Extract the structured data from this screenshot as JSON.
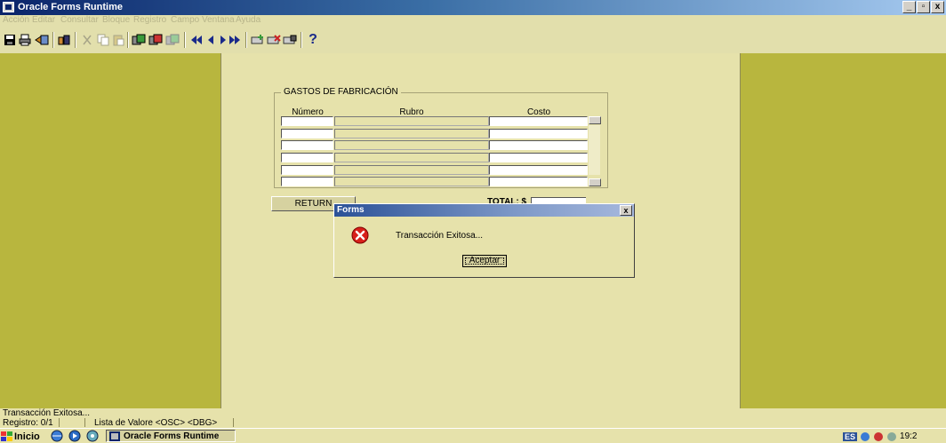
{
  "window": {
    "title": "Oracle Forms Runtime"
  },
  "menu": [
    "Acción",
    "Editar",
    "Consultar",
    "Bloque",
    "Registro",
    "Campo",
    "Ventana",
    "Ayuda"
  ],
  "toolbar": {
    "icons": [
      "save-icon",
      "print-icon",
      "exit-icon",
      "enter-query-icon",
      "cut-icon",
      "copy-icon",
      "paste-icon",
      "insert-record-icon",
      "duplicate-record-icon",
      "clear-record-icon",
      "first-record-icon",
      "previous-record-icon",
      "next-record-icon",
      "last-record-icon",
      "insert-icon",
      "delete-record-icon",
      "lock-record-icon",
      "help-icon"
    ],
    "help_label": "?"
  },
  "form": {
    "frame_title": "GASTOS DE FABRICACIÓN",
    "columns": [
      "Número",
      "Rubro",
      "Costo"
    ],
    "rows": 6,
    "return_label": "RETURN",
    "total_label": "TOTAL: $"
  },
  "dialog": {
    "title": "Forms",
    "close_label": "x",
    "message": "Transacción Exitosa...",
    "ok_label": "Aceptar"
  },
  "status": {
    "message": "Transacción Exitosa...",
    "record": "Registro: 0/1",
    "lov": "Lista de Valore <OSC> <DBG>"
  },
  "taskbar": {
    "start_label": "Inicio",
    "task_label": "Oracle Forms Runtime",
    "lang": "ES",
    "clock": "19:2"
  }
}
